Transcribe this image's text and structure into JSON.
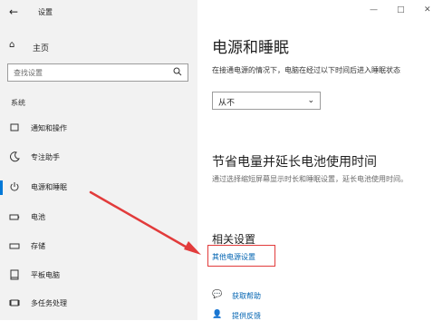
{
  "window": {
    "title": "设置",
    "back_icon": "←",
    "controls": [
      "—",
      "□",
      "✕"
    ]
  },
  "sidebar": {
    "home": {
      "icon": "⌂",
      "label": "主页"
    },
    "search": {
      "placeholder": "查找设置"
    },
    "section_label": "系统",
    "items": [
      {
        "label": "通知和操作",
        "icon": "bell-icon"
      },
      {
        "label": "专注助手",
        "icon": "moon-icon"
      },
      {
        "label": "电源和睡眠",
        "icon": "power-icon",
        "active": true
      },
      {
        "label": "电池",
        "icon": "battery-icon"
      },
      {
        "label": "存储",
        "icon": "storage-icon"
      },
      {
        "label": "平板电脑",
        "icon": "tablet-icon"
      },
      {
        "label": "多任务处理",
        "icon": "multitask-icon"
      }
    ]
  },
  "main": {
    "power_title": "电源和睡眠",
    "power_desc": "在接通电源的情况下，电脑在经过以下时间后进入睡眠状态",
    "sleep_select": "从不",
    "battery_title": "节省电量并延长电池使用时间",
    "battery_desc": "通过选择缩短屏幕显示时长和睡眠设置，延长电池使用时间。",
    "related_title": "相关设置",
    "related_link": "其他电源设置",
    "help_label": "获取帮助",
    "feedback_label": "提供反馈"
  },
  "colors": {
    "accent": "#0078d7",
    "link": "#0063b1",
    "annotation": "#e23b3b"
  }
}
